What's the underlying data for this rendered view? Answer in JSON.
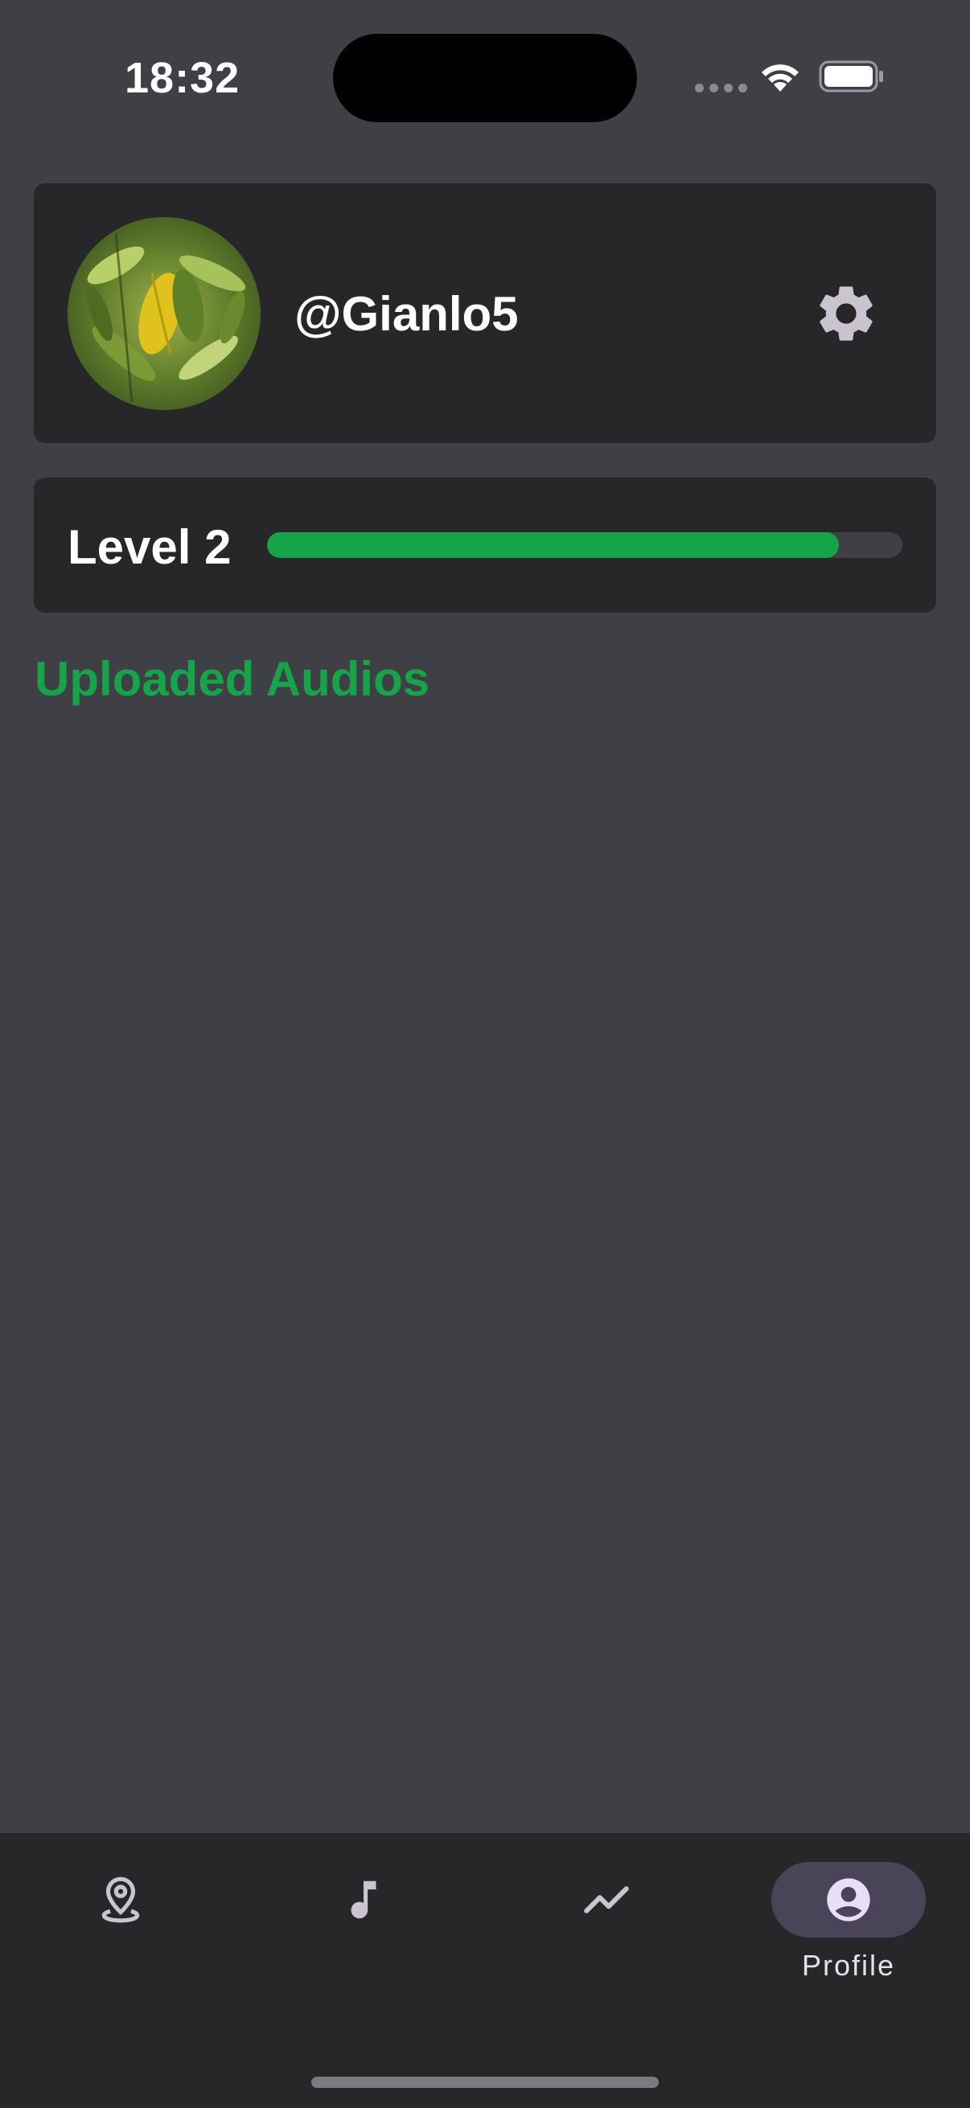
{
  "status_bar": {
    "time": "18:32",
    "icons": [
      "signal-dots-icon",
      "wifi-icon",
      "battery-icon"
    ]
  },
  "profile": {
    "username": "@Gianlo5",
    "avatar": "leaf-photo",
    "settings_icon": "gear-icon"
  },
  "level": {
    "label": "Level 2",
    "progress_percent": 90
  },
  "uploaded_section": {
    "title": "Uploaded Audios"
  },
  "bottom_nav": {
    "items": [
      {
        "icon": "location-pin-icon",
        "label": "",
        "active": false
      },
      {
        "icon": "music-note-icon",
        "label": "",
        "active": false
      },
      {
        "icon": "trending-line-icon",
        "label": "",
        "active": false
      },
      {
        "icon": "account-circle-icon",
        "label": "Profile",
        "active": true
      }
    ]
  },
  "colors": {
    "background": "#3f3f46",
    "card": "#27272a",
    "accent": "#16a34a",
    "active_pill": "#4a4458",
    "icon": "#cac4d0"
  }
}
